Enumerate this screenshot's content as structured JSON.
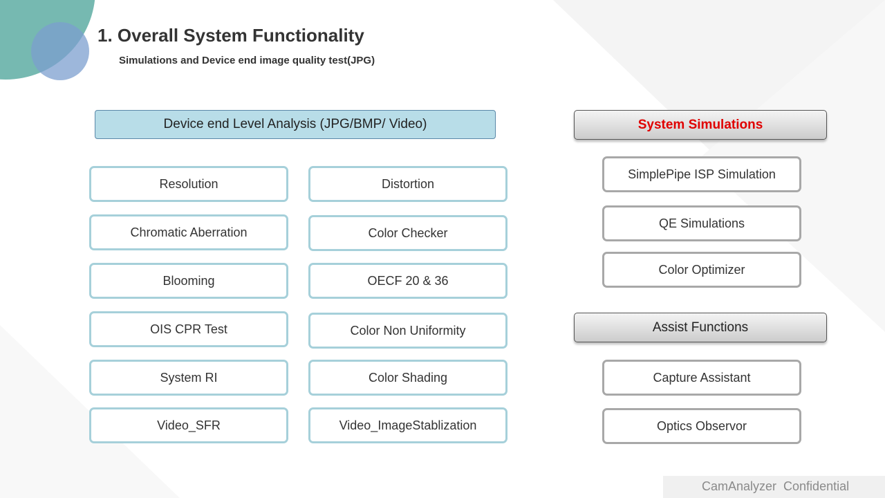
{
  "slide": {
    "title": "1. Overall System Functionality",
    "subtitle": "Simulations and Device end image quality test(JPG)",
    "footer": "CamAnalyzer  Confidential"
  },
  "device_analysis": {
    "header": "Device end Level Analysis (JPG/BMP/ Video)",
    "left_column": [
      "Resolution",
      "Chromatic Aberration",
      "Blooming",
      "OIS CPR Test",
      "System RI",
      "Video_SFR"
    ],
    "right_column": [
      "Distortion",
      "Color Checker",
      "OECF 20 & 36",
      "Color Non Uniformity",
      "Color Shading",
      "Video_ImageStablization"
    ]
  },
  "system_simulations": {
    "header": "System Simulations",
    "items": [
      "SimplePipe ISP Simulation",
      "QE Simulations",
      "Color Optimizer"
    ]
  },
  "assist_functions": {
    "header": "Assist Functions",
    "items": [
      "Capture Assistant",
      "Optics Observor"
    ]
  },
  "colors": {
    "device_header_fill": "#b8dde8",
    "teal_border": "#a6d0da",
    "gray_border": "#a8a8a8",
    "sim_header_text": "#e00000",
    "corner_circle_teal": "#76b9b1",
    "corner_circle_blue": "#7c9fcf"
  }
}
